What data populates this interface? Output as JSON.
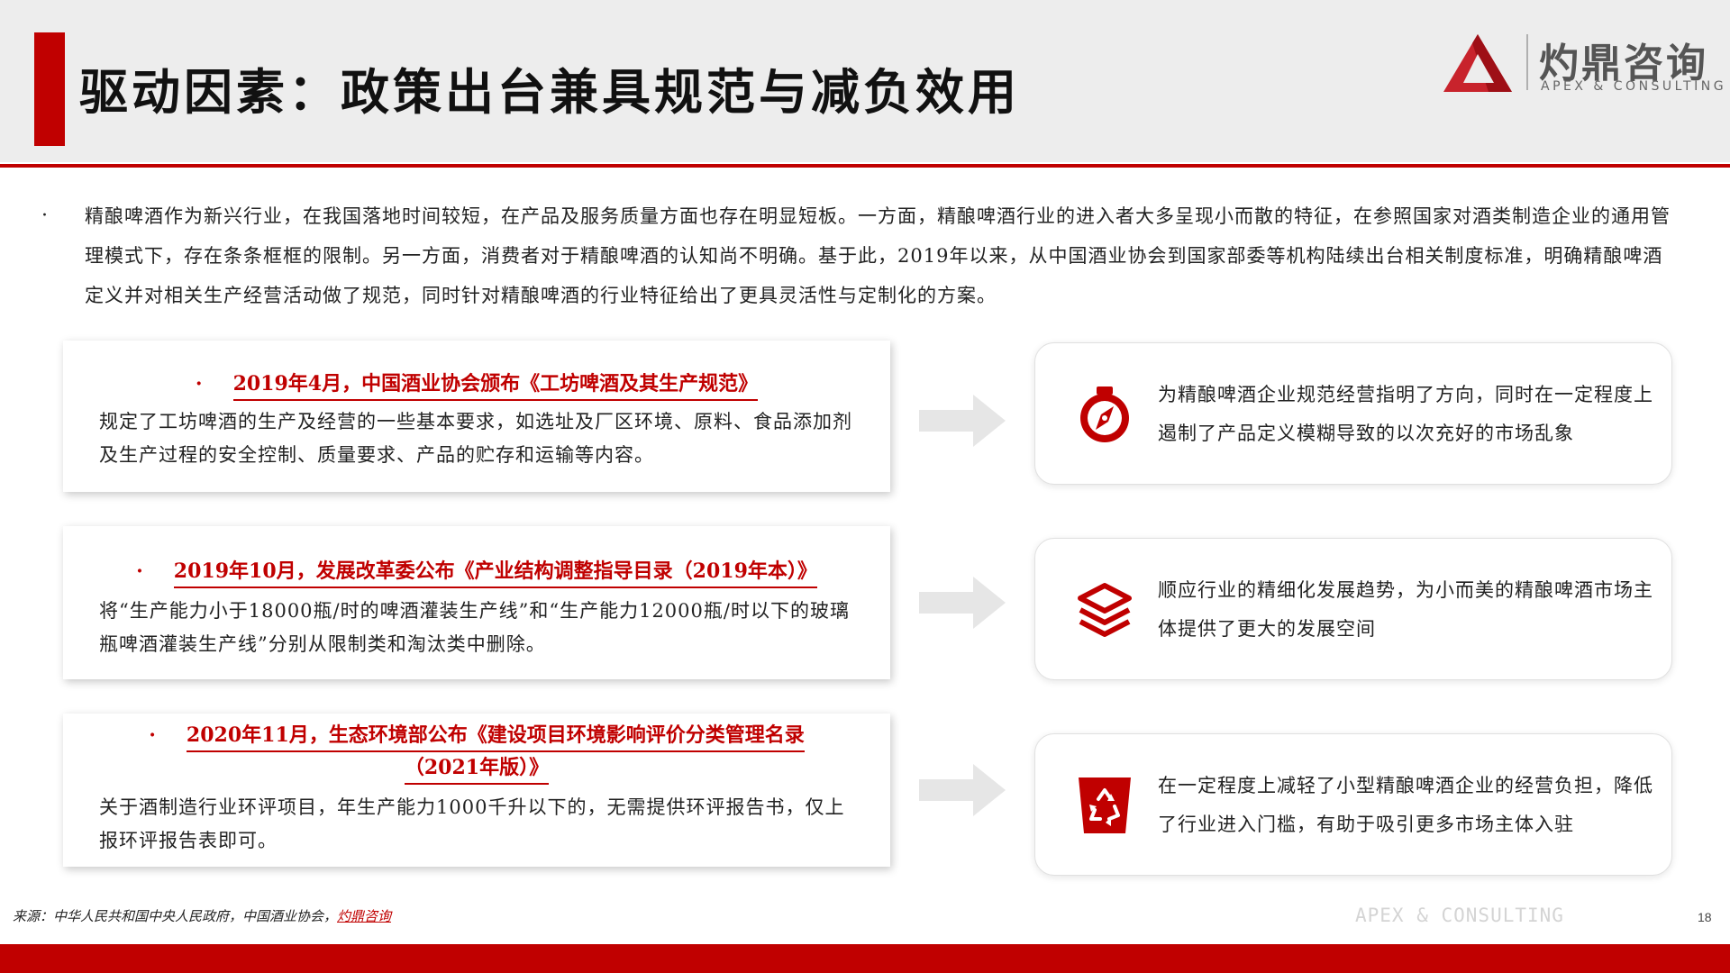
{
  "header": {
    "title": "驱动因素：政策出台兼具规范与减负效用",
    "logo_cn": "灼鼎咨询",
    "logo_en": "APEX & CONSULTING"
  },
  "intro": {
    "bullet": "·",
    "text": "精酿啤酒作为新兴行业，在我国落地时间较短，在产品及服务质量方面也存在明显短板。一方面，精酿啤酒行业的进入者大多呈现小而散的特征，在参照国家对酒类制造企业的通用管理模式下，存在条条框框的限制。另一方面，消费者对于精酿啤酒的认知尚不明确。基于此，2019年以来，从中国酒业协会到国家部委等机构陆续出台相关制度标准，明确精酿啤酒定义并对相关生产经营活动做了规范，同时针对精酿啤酒的行业特征给出了更具灵活性与定制化的方案。"
  },
  "policies": [
    {
      "bullet": "·",
      "title": "2019年4月，中国酒业协会颁布《工坊啤酒及其生产规范》",
      "body": "规定了工坊啤酒的生产及经营的一些基本要求，如选址及厂区环境、原料、食品添加剂及生产过程的安全控制、质量要求、产品的贮存和运输等内容。"
    },
    {
      "bullet": "·",
      "title": "2019年10月，发展改革委公布《产业结构调整指导目录（2019年本）》",
      "body": "将“生产能力小于18000瓶/时的啤酒灌装生产线”和“生产能力12000瓶/时以下的玻璃瓶啤酒灌装生产线”分别从限制类和淘汰类中删除。"
    },
    {
      "bullet": "·",
      "title_line1": "2020年11月，生态环境部公布《建设项目环境影响评价分类管理名录",
      "title_line2": "（2021年版）》",
      "body": "关于酒制造行业环评项目，年生产能力1000千升以下的，无需提供环评报告书，仅上报环评报告表即可。"
    }
  ],
  "results": [
    {
      "icon": "compass-icon",
      "text": "为精酿啤酒企业规范经营指明了方向，同时在一定程度上遏制了产品定义模糊导致的以次充好的市场乱象"
    },
    {
      "icon": "layers-icon",
      "text": "顺应行业的精细化发展趋势，为小而美的精酿啤酒市场主体提供了更大的发展空间"
    },
    {
      "icon": "recycle-icon",
      "text": "在一定程度上减轻了小型精酿啤酒企业的经营负担，降低了行业进入门槛，有助于吸引更多市场主体入驻"
    }
  ],
  "footer": {
    "source_prefix": "来源：中华人民共和国中央人民政府，中国酒业协会，",
    "source_link": "灼鼎咨询",
    "watermark": "APEX & CONSULTING",
    "page": "18"
  },
  "colors": {
    "accent": "#c00000",
    "header_bg": "#ededed",
    "arrow": "#e6e6e6"
  }
}
